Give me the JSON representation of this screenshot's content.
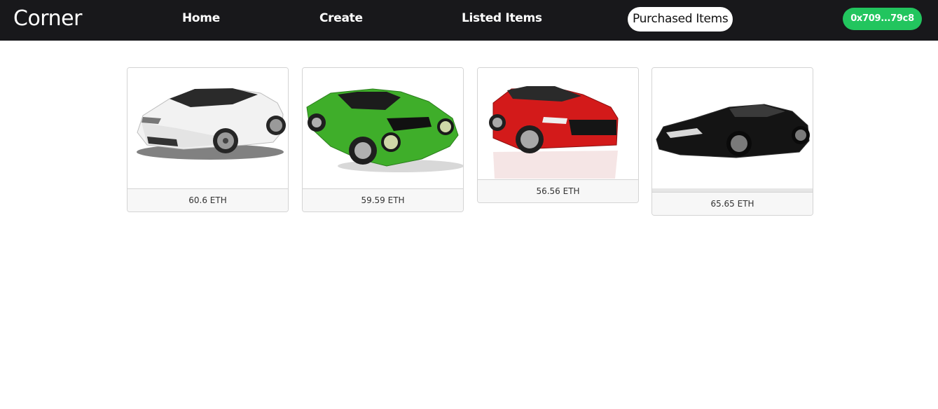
{
  "brand": "Corner",
  "nav": {
    "home": "Home",
    "create": "Create",
    "listed": "Listed Items",
    "purchased": "Purchased Items"
  },
  "wallet": {
    "address": "0x709...79c8",
    "color": "#22c55e"
  },
  "items": [
    {
      "price": "60.6 ETH",
      "image": "white-sports-car"
    },
    {
      "price": "59.59 ETH",
      "image": "green-classic-sports-car"
    },
    {
      "price": "56.56 ETH",
      "image": "red-sedan"
    },
    {
      "price": "65.65 ETH",
      "image": "black-hypercar"
    }
  ]
}
